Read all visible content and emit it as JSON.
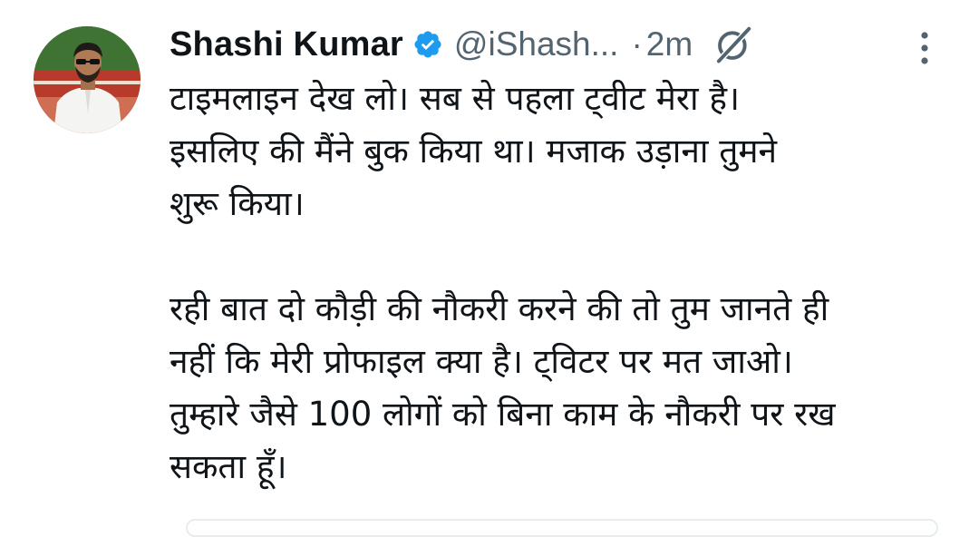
{
  "tweet": {
    "author_name": "Shashi Kumar",
    "handle": "@iShash...",
    "separator": "·",
    "time": "2m",
    "paragraph1_lines": [
      "टाइमलाइन देख लो। सब से पहला ट्वीट मेरा है।",
      "इसलिए की मैंने बुक किया था। मजाक उड़ाना तुमने",
      "शुरू किया।"
    ],
    "paragraph2_lines": [
      "रही बात दो कौड़ी की नौकरी करने की तो तुम जानते ही",
      "नहीं कि मेरी प्रोफाइल क्या है। ट्विटर पर मत जाओ।",
      "तुम्हारे जैसे 100 लोगों को बिना काम के नौकरी पर रख",
      "सकता हूँ।"
    ]
  },
  "icons": {
    "verified": "verified-badge-icon",
    "grok": "grok-icon",
    "more": "more-options-icon"
  },
  "colors": {
    "text": "#0f1419",
    "secondary": "#536471",
    "verified": "#1d9bf0",
    "background": "#ffffff"
  }
}
